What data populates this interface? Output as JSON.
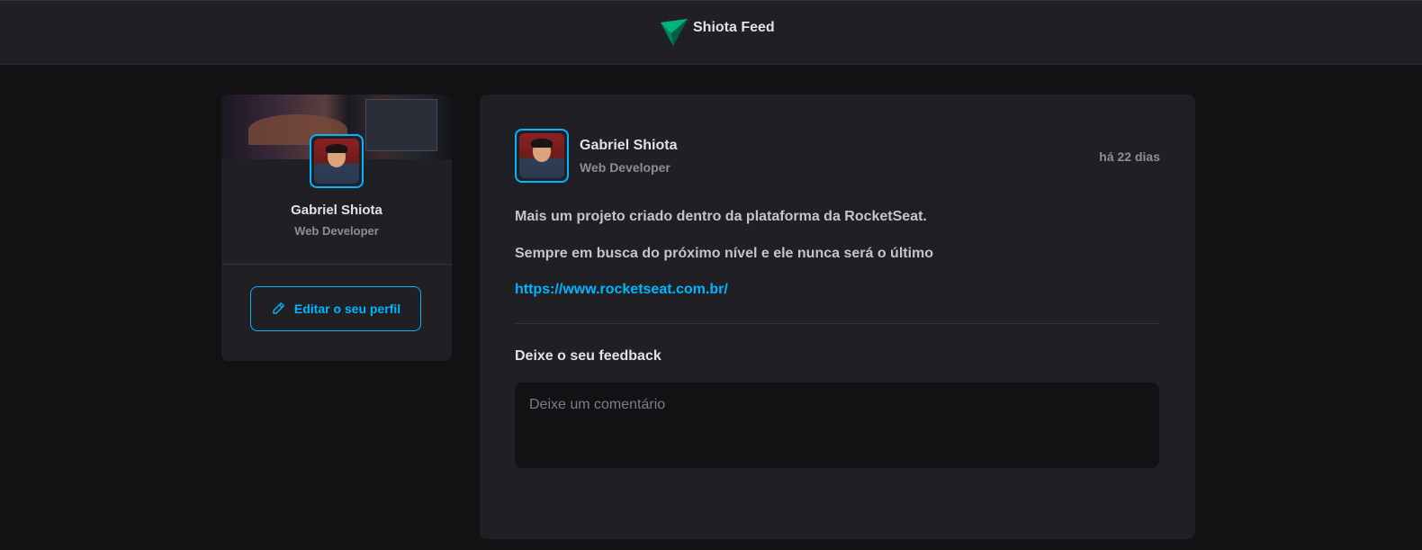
{
  "header": {
    "app_title": "Shiota Feed",
    "logo_icon": "ignite-logo-icon",
    "brand_colors": [
      "#00875f",
      "#00b37e"
    ]
  },
  "sidebar": {
    "name": "Gabriel Shiota",
    "role": "Web Developer",
    "edit_button_label": "Editar o seu perfil",
    "edit_icon": "pencil-icon"
  },
  "post": {
    "author_name": "Gabriel Shiota",
    "author_role": "Web Developer",
    "published_relative": "há 22 dias",
    "paragraphs": [
      "Mais um projeto criado dentro da plataforma da RocketSeat.",
      "Sempre em busca do próximo nível e ele nunca será o último"
    ],
    "link": "https://www.rocketseat.com.br/",
    "feedback_title": "Deixe o seu feedback",
    "comment_placeholder": "Deixe um comentário"
  },
  "colors": {
    "accent": "#00b7ff",
    "background": "#121214",
    "card": "#202024"
  }
}
